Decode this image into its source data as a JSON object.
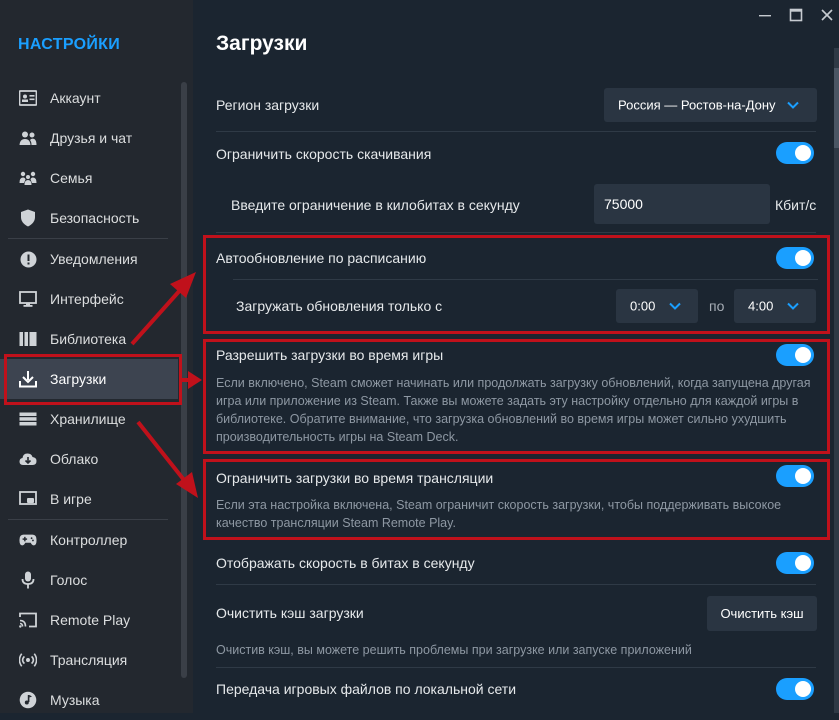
{
  "sidebar": {
    "title": "НАСТРОЙКИ",
    "items": [
      {
        "label": "Аккаунт",
        "icon": "account-card-icon"
      },
      {
        "label": "Друзья и чат",
        "icon": "friends-icon"
      },
      {
        "label": "Семья",
        "icon": "family-icon"
      },
      {
        "label": "Безопасность",
        "icon": "shield-icon"
      },
      {
        "label": "Уведомления",
        "icon": "alert-icon"
      },
      {
        "label": "Интерфейс",
        "icon": "monitor-icon"
      },
      {
        "label": "Библиотека",
        "icon": "library-icon"
      },
      {
        "label": "Загрузки",
        "icon": "download-icon"
      },
      {
        "label": "Хранилище",
        "icon": "storage-icon"
      },
      {
        "label": "Облако",
        "icon": "cloud-icon"
      },
      {
        "label": "В игре",
        "icon": "in-game-icon"
      },
      {
        "label": "Контроллер",
        "icon": "controller-icon"
      },
      {
        "label": "Голос",
        "icon": "microphone-icon"
      },
      {
        "label": "Remote Play",
        "icon": "cast-icon"
      },
      {
        "label": "Трансляция",
        "icon": "broadcast-icon"
      },
      {
        "label": "Музыка",
        "icon": "music-icon"
      }
    ],
    "active_index": 7
  },
  "main": {
    "title": "Загрузки",
    "region": {
      "label": "Регион загрузки",
      "value": "Россия — Ростов-на-Дону"
    },
    "limit_speed": {
      "label": "Ограничить скорость скачивания",
      "enabled": true
    },
    "limit_value": {
      "label": "Введите ограничение в килобитах в секунду",
      "value": "75000",
      "unit": "Кбит/с"
    },
    "auto_update": {
      "label": "Автообновление по расписанию",
      "enabled": true
    },
    "update_window": {
      "label": "Загружать обновления только с",
      "from": "0:00",
      "sep": "по",
      "to": "4:00"
    },
    "allow_during_game": {
      "label": "Разрешить загрузки во время игры",
      "enabled": true,
      "desc": "Если включено, Steam сможет начинать или продолжать загрузку обновлений, когда запущена другая игра или приложение из Steam. Также вы можете задать эту настройку отдельно для каждой игры в библиотеке. Обратите внимание, что загрузка обновлений во время игры может сильно ухудшить производительность игры на Steam Deck."
    },
    "limit_during_stream": {
      "label": "Ограничить загрузки во время трансляции",
      "enabled": true,
      "desc": "Если эта настройка включена, Steam ограничит скорость загрузки, чтобы поддерживать высокое качество трансляции Steam Remote Play."
    },
    "bits_per_second": {
      "label": "Отображать скорость в битах в секунду",
      "enabled": true
    },
    "clear_cache": {
      "label": "Очистить кэш загрузки",
      "button": "Очистить кэш",
      "desc": "Очистив кэш, вы можете решить проблемы при загрузке или запуске приложений"
    },
    "lan_transfer": {
      "label": "Передача игровых файлов по локальной сети",
      "enabled": true
    }
  },
  "colors": {
    "accent": "#1a9fff",
    "highlight": "#c0111b",
    "background": "#1b2530",
    "sidebar": "#23282f"
  }
}
